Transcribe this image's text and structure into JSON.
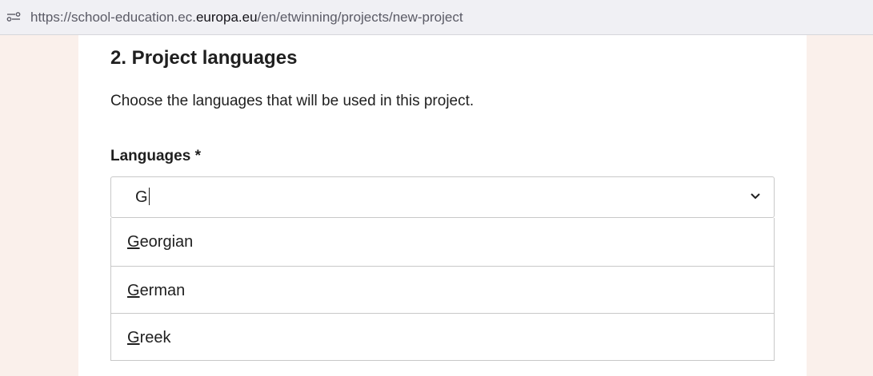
{
  "browser": {
    "url_prefix": "https://school-education.ec.",
    "url_domain": "europa.eu",
    "url_suffix": "/en/etwinning/projects/new-project",
    "site_icon": "site-settings-icon"
  },
  "section": {
    "title": "2. Project languages",
    "description": "Choose the languages that will be used in this project."
  },
  "languages_field": {
    "label": "Languages *",
    "input_value": "G",
    "toggle_icon": "chevron-down-icon",
    "options": [
      {
        "match": "G",
        "rest": "eorgian"
      },
      {
        "match": "G",
        "rest": "erman"
      },
      {
        "match": "G",
        "rest": "reek"
      }
    ]
  }
}
